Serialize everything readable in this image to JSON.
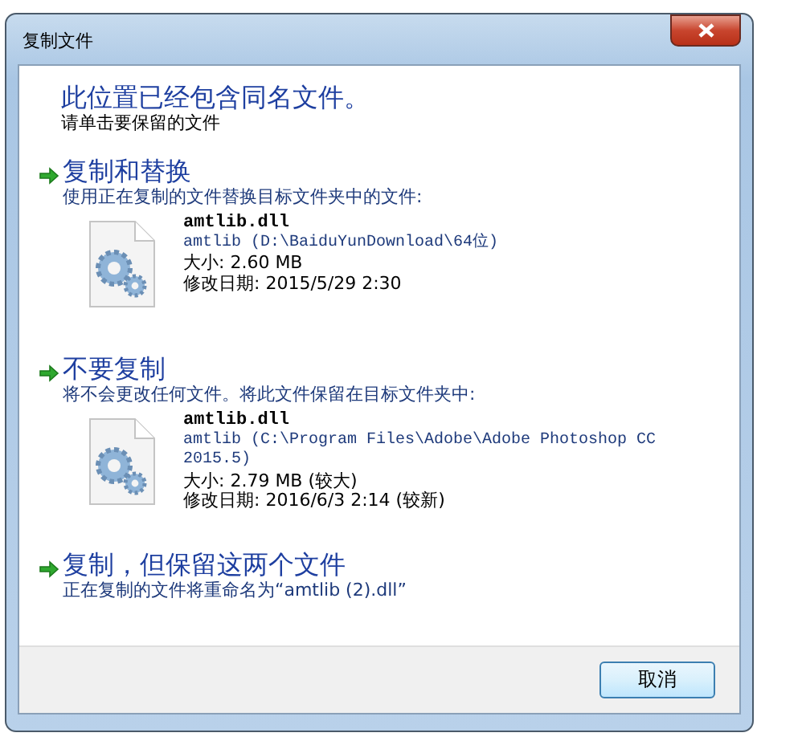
{
  "window": {
    "title": "复制文件"
  },
  "heading": "此位置已经包含同名文件。",
  "instruction": "请单击要保留的文件",
  "options": [
    {
      "title": "复制和替换",
      "description": "使用正在复制的文件替换目标文件夹中的文件:",
      "file": {
        "name": "amtlib.dll",
        "location": "amtlib (D:\\BaiduYunDownload\\64位)",
        "size": "大小: 2.60 MB",
        "modified": "修改日期: 2015/5/29 2:30"
      }
    },
    {
      "title": "不要复制",
      "description": "将不会更改任何文件。将此文件保留在目标文件夹中:",
      "file": {
        "name": "amtlib.dll",
        "location": "amtlib (C:\\Program Files\\Adobe\\Adobe Photoshop CC 2015.5)",
        "size": "大小: 2.79 MB (较大)",
        "modified": "修改日期: 2016/6/3 2:14 (较新)"
      }
    },
    {
      "title": "复制，但保留这两个文件",
      "description": "正在复制的文件将重命名为“amtlib (2).dll”"
    }
  ],
  "buttons": [
    "取消"
  ]
}
